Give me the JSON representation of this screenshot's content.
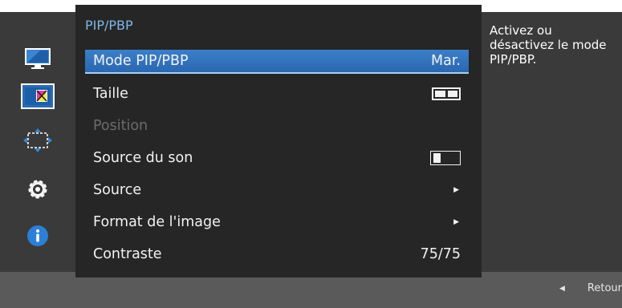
{
  "menu": {
    "title": "PIP/PBP",
    "items": [
      {
        "label": "Mode PIP/PBP",
        "value": "Mar."
      },
      {
        "label": "Taille",
        "value": ""
      },
      {
        "label": "Position",
        "value": ""
      },
      {
        "label": "Source du son",
        "value": ""
      },
      {
        "label": "Source",
        "value": ""
      },
      {
        "label": "Format de l'image",
        "value": ""
      },
      {
        "label": "Contraste",
        "value": "75/75"
      }
    ]
  },
  "side_icons": [
    "monitor-icon",
    "color-picture-icon",
    "resize-arrows-icon",
    "gear-icon",
    "info-icon"
  ],
  "help_text": "Activez ou désactivez le mode PIP/PBP.",
  "footer": {
    "back_label": "Retour"
  },
  "colors": {
    "accent": "#2b6cb2",
    "title": "#7fb7e8"
  }
}
